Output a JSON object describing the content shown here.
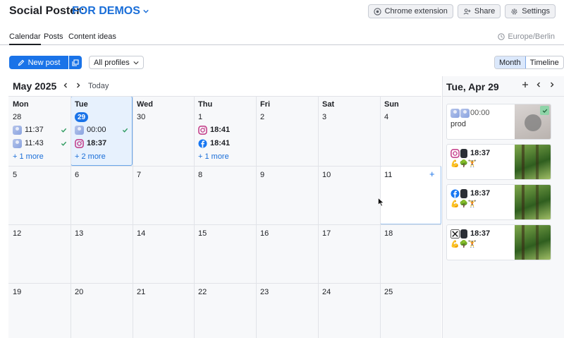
{
  "header": {
    "app_title": "Social Poster:",
    "project": "FOR DEMOS",
    "buttons": {
      "chrome": "Chrome extension",
      "share": "Share",
      "settings": "Settings"
    }
  },
  "tabs": [
    {
      "label": "Calendar",
      "active": true
    },
    {
      "label": "Posts"
    },
    {
      "label": "Content ideas"
    }
  ],
  "timezone": "Europe/Berlin",
  "toolbar": {
    "new_post": "New post",
    "profiles": "All profiles",
    "month": "Month",
    "timeline": "Timeline"
  },
  "calendar": {
    "title": "May 2025",
    "today": "Today",
    "weekdays": [
      "Mon",
      "Tue",
      "Wed",
      "Thu",
      "Fri",
      "Sat",
      "Sun"
    ],
    "weeks": [
      [
        "28",
        "29",
        "30",
        "1",
        "2",
        "3",
        "4"
      ],
      [
        "5",
        "6",
        "7",
        "8",
        "9",
        "10",
        "11"
      ],
      [
        "12",
        "13",
        "14",
        "15",
        "16",
        "17",
        "18"
      ],
      [
        "19",
        "20",
        "21",
        "22",
        "23",
        "24",
        "25"
      ]
    ],
    "posts": {
      "mon_1": "11:37",
      "mon_2": "11:43",
      "mon_more": "+ 1 more",
      "tue_1": "00:00",
      "tue_2": "18:37",
      "tue_more": "+ 2 more",
      "thu_1": "18:41",
      "thu_2": "18:41",
      "thu_more": "+ 1 more"
    },
    "add_symbol": "+"
  },
  "panel": {
    "title": "Tue, Apr 29",
    "cards": [
      {
        "time": "00:00",
        "text": "prod"
      },
      {
        "time": "18:37",
        "text": "💪🌳🏋"
      },
      {
        "time": "18:37",
        "text": "💪🌳🏋"
      },
      {
        "time": "18:37",
        "text": "💪🌳🏋"
      }
    ]
  },
  "colors": {
    "accent": "#1a73e8",
    "check": "#2e9b5f"
  }
}
